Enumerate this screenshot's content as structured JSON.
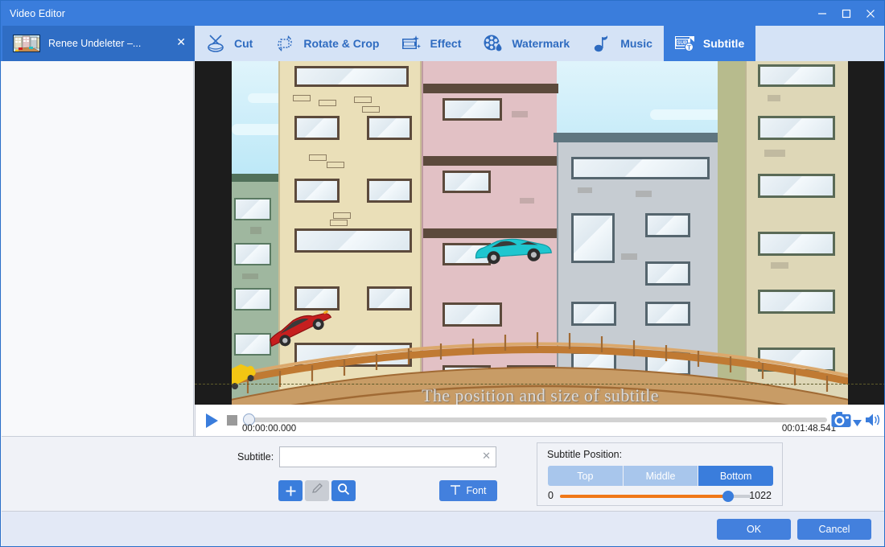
{
  "window": {
    "title": "Video Editor",
    "controls": [
      {
        "name": "minimize",
        "glyph": "minimize-icon"
      },
      {
        "name": "maximize",
        "glyph": "maximize-icon"
      },
      {
        "name": "close",
        "glyph": "close-icon"
      }
    ]
  },
  "file_tab": {
    "label": "Renee Undeleter –...",
    "close_label": "✕",
    "thumbnail_icon": "video-thumbnail"
  },
  "toolbar": {
    "items": [
      {
        "label": "Cut",
        "icon": "scissors-icon",
        "active": false
      },
      {
        "label": "Rotate & Crop",
        "icon": "rotate-crop-icon",
        "active": false
      },
      {
        "label": "Effect",
        "icon": "film-sparkle-icon",
        "active": false
      },
      {
        "label": "Watermark",
        "icon": "film-reel-drop-icon",
        "active": false
      },
      {
        "label": "Music",
        "icon": "music-note-icon",
        "active": false
      },
      {
        "label": "Subtitle",
        "icon": "subtitle-icon",
        "active": true
      }
    ]
  },
  "preview": {
    "subtitle_overlay_text": "The position and size of subtitle",
    "guide_line": "dashed-subtitle-boundary"
  },
  "player": {
    "play_icon": "play-icon",
    "stop_icon": "stop-icon",
    "current_time": "00:00:00.000",
    "total_time": "00:01:48.541",
    "seek_value": 0,
    "snapshot_icon": "camera-icon",
    "snapshot_caret_icon": "chevron-down-icon",
    "volume_icon": "volume-icon"
  },
  "subtitle_panel": {
    "label": "Subtitle:",
    "input_value": "",
    "input_placeholder": "",
    "clear_label": "✕",
    "add_label": "+",
    "edit_label": "edit-pencil-icon",
    "search_label": "search-icon",
    "font_label": "Font",
    "font_icon": "text-T-icon"
  },
  "position_panel": {
    "title": "Subtitle Position:",
    "options": [
      "Top",
      "Middle",
      "Bottom"
    ],
    "selected": "Bottom",
    "slider": {
      "min_label": "0",
      "max_label": "1022",
      "min": 0,
      "max": 1022,
      "value": 930,
      "fill_color": "#f07818",
      "thumb_color": "#3a7ddc"
    }
  },
  "footer": {
    "ok_label": "OK",
    "cancel_label": "Cancel"
  },
  "colors": {
    "accent": "#3a7ddc",
    "titlebar": "#3a7ddc",
    "toolbar_bg": "#d5e3f6",
    "panel_bg": "#f0f2f7",
    "footer_bg": "#e3e9f6",
    "slider_orange": "#f07818"
  }
}
